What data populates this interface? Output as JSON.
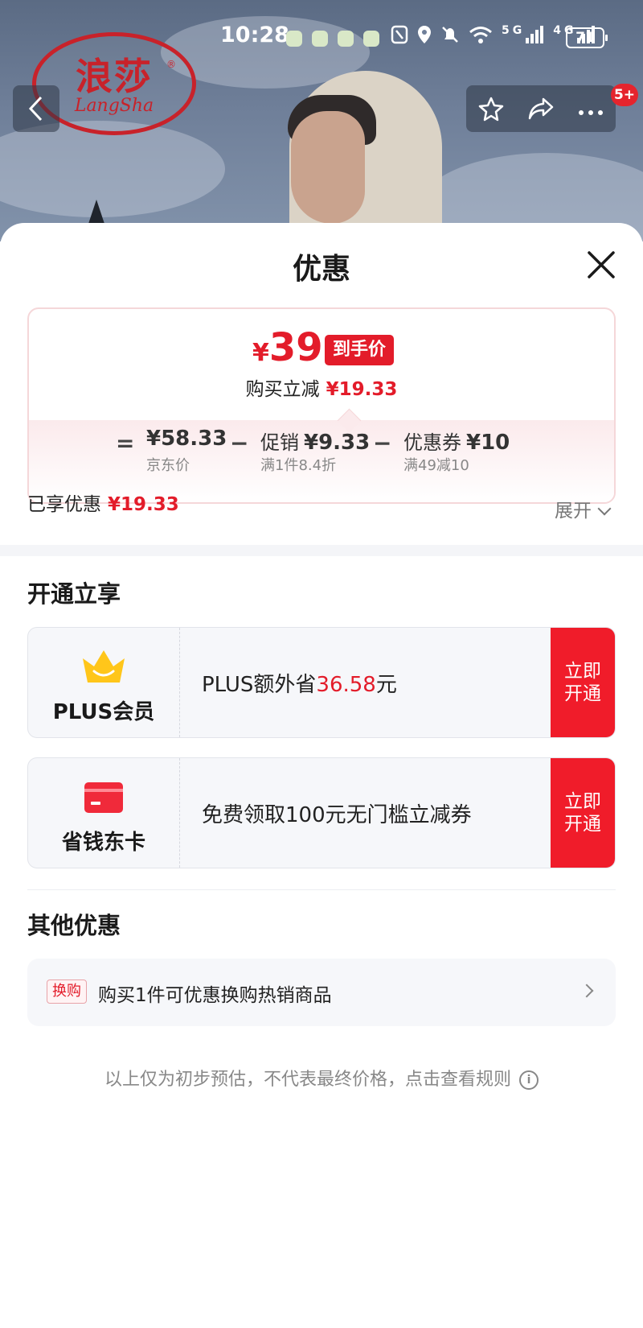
{
  "status_bar": {
    "time": "10:28",
    "network_5g": "5G",
    "network_4g": "4G",
    "battery": "71"
  },
  "hero": {
    "brand_cn": "浪莎",
    "brand_en": "LangSha",
    "brand_mark": "®",
    "cart_badge": "5+"
  },
  "icons": {
    "back": "chevron-left-icon",
    "favorite": "star-icon",
    "share": "share-icon",
    "more": "more-icon",
    "close": "close-icon",
    "plus_member": "crown-icon",
    "saving_card": "card-icon",
    "info": "info-icon"
  },
  "sheet": {
    "title": "优惠",
    "price_card": {
      "currency": "¥",
      "final_price": "39",
      "final_tag": "到手价",
      "instant_cut_label": "购买立减",
      "instant_cut_value": "¥19.33",
      "formula": {
        "equals": "=",
        "minus": "−",
        "jd_price": "¥58.33",
        "jd_price_label": "京东价",
        "promo_label": "促销",
        "promo_value": "¥9.33",
        "promo_sub": "满1件8.4折",
        "coupon_label": "优惠券",
        "coupon_value": "¥10",
        "coupon_sub": "满49减10"
      }
    },
    "enjoyed_label": "已享优惠",
    "enjoyed_value": "¥19.33",
    "expand_label": "展开",
    "open_section": {
      "title": "开通立享",
      "cards": [
        {
          "name": "PLUS会员",
          "desc_prefix": "PLUS额外省",
          "desc_value": "36.58",
          "desc_suffix": "元",
          "button": "立即开通"
        },
        {
          "name": "省钱东卡",
          "desc": "免费领取100元无门槛立减券",
          "button": "立即开通"
        }
      ]
    },
    "other_section": {
      "title": "其他优惠",
      "item_tag": "换购",
      "item_text": "购买1件可优惠换购热销商品"
    },
    "disclaimer": "以上仅为初步预估，不代表最终价格，点击查看规则",
    "info_glyph": "i"
  },
  "colors": {
    "accent_red": "#e31c2a",
    "button_red": "#f01c2a",
    "card_bg": "#f6f7fa"
  }
}
